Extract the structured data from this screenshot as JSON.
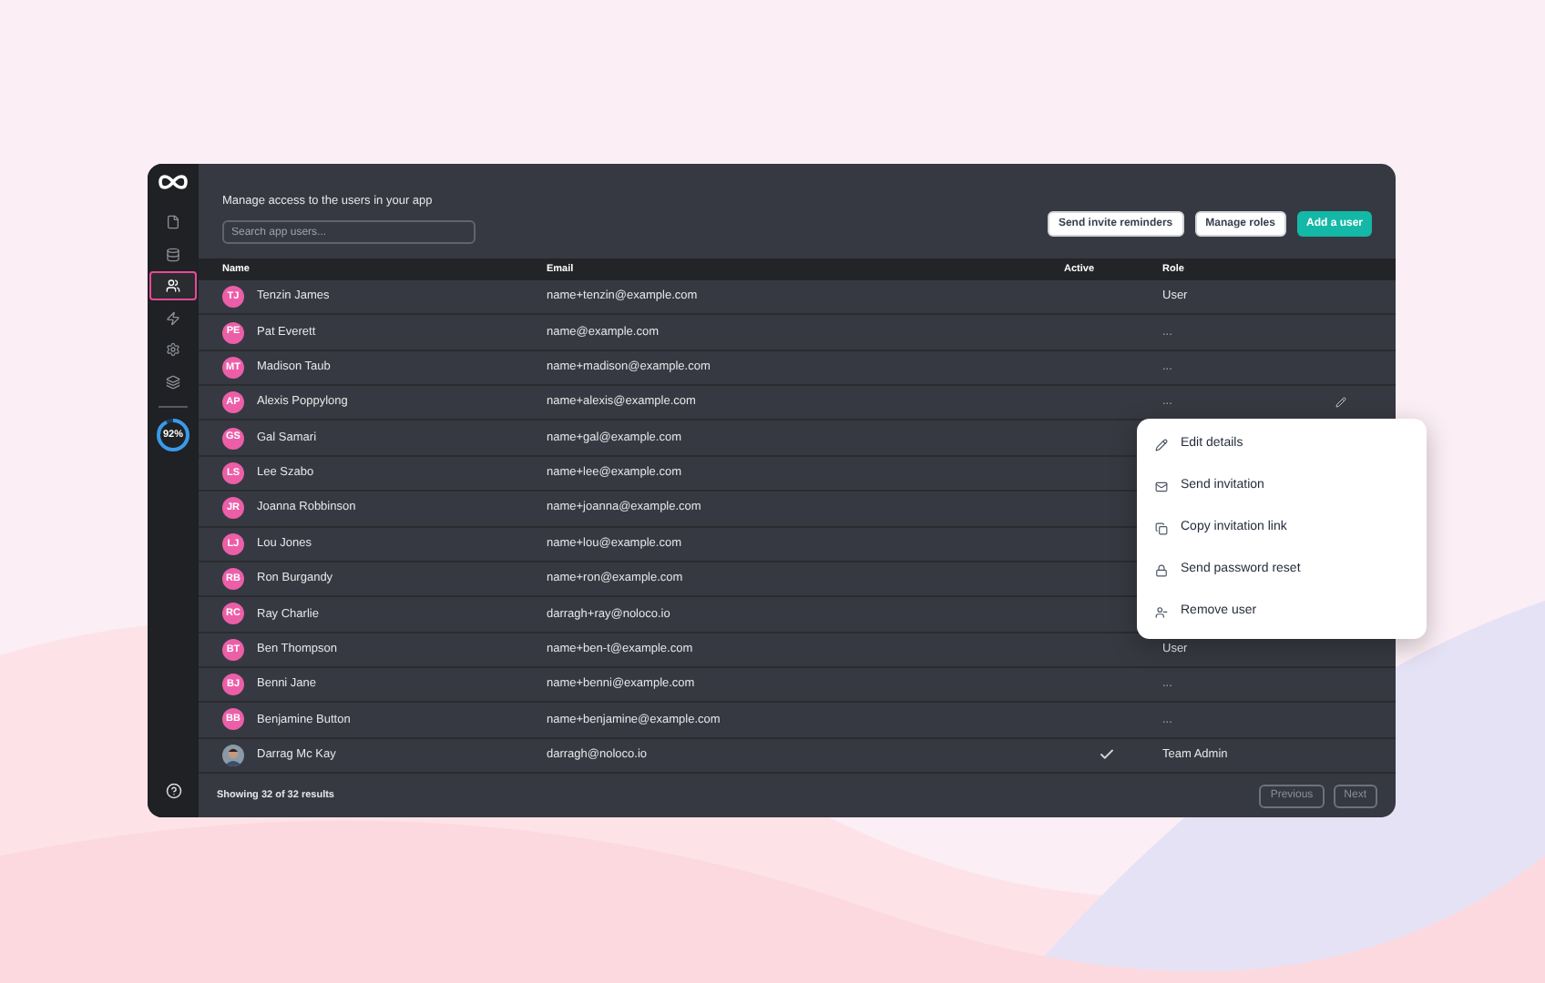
{
  "sidebar": {
    "items": [
      {
        "selected": false
      },
      {
        "selected": false
      },
      {
        "selected": true
      },
      {
        "selected": false
      },
      {
        "selected": false
      },
      {
        "selected": false
      }
    ],
    "usage": {
      "label": "92%"
    }
  },
  "header": {
    "subtitle": "Manage access to the users in your app",
    "search": {
      "placeholder": "Search app users..."
    },
    "buttons": [
      {
        "label": "Send invite reminders",
        "kind": "secondary"
      },
      {
        "label": "Manage roles",
        "kind": "secondary"
      },
      {
        "label": "Add a user",
        "kind": "primary"
      }
    ]
  },
  "table": {
    "columns": [
      "Name",
      "Email",
      "Active",
      "Role"
    ],
    "rows": [
      {
        "kind": "initials",
        "initials": "TJ",
        "name": "Tenzin James",
        "email": "name+tenzin@example.com",
        "active": false,
        "role": "User",
        "edit": false
      },
      {
        "kind": "initials",
        "initials": "PE",
        "name": "Pat Everett",
        "email": "name@example.com",
        "active": false,
        "role": "...",
        "edit": false
      },
      {
        "kind": "initials",
        "initials": "MT",
        "name": "Madison Taub",
        "email": "name+madison@example.com",
        "active": false,
        "role": "...",
        "edit": false
      },
      {
        "kind": "initials",
        "initials": "AP",
        "name": "Alexis Poppylong",
        "email": "name+alexis@example.com",
        "active": false,
        "role": "...",
        "edit": true
      },
      {
        "kind": "initials",
        "initials": "GS",
        "name": "Gal Samari",
        "email": "name+gal@example.com",
        "active": false
      },
      {
        "kind": "initials",
        "initials": "LS",
        "name": "Lee Szabo",
        "email": "name+lee@example.com",
        "active": false
      },
      {
        "kind": "initials",
        "initials": "JR",
        "name": "Joanna Robbinson",
        "email": "name+joanna@example.com",
        "active": false
      },
      {
        "kind": "initials",
        "initials": "LJ",
        "name": "Lou Jones",
        "email": "name+lou@example.com",
        "active": false
      },
      {
        "kind": "initials",
        "initials": "RB",
        "name": "Ron Burgandy",
        "email": "name+ron@example.com",
        "active": false
      },
      {
        "kind": "initials",
        "initials": "RC",
        "name": "Ray Charlie",
        "email": "darragh+ray@noloco.io",
        "active": false
      },
      {
        "kind": "initials",
        "initials": "BT",
        "name": "Ben Thompson",
        "email": "name+ben-t@example.com",
        "active": false,
        "role": "User",
        "edit": false
      },
      {
        "kind": "initials",
        "initials": "BJ",
        "name": "Benni Jane",
        "email": "name+benni@example.com",
        "active": false,
        "role": "...",
        "edit": false
      },
      {
        "kind": "initials",
        "initials": "BB",
        "name": "Benjamine Button",
        "email": "name+benjamine@example.com",
        "active": false,
        "role": "...",
        "edit": false
      },
      {
        "kind": "picture",
        "name": "Darrag Mc Kay",
        "email": "darragh@noloco.io",
        "active": true,
        "role": "Team Admin",
        "edit": false
      }
    ]
  },
  "footer": {
    "summary": "Showing 32 of 32 results",
    "buttons": [
      "Previous",
      "Next"
    ]
  },
  "context_menu": {
    "items": [
      {
        "label": "Edit details"
      },
      {
        "label": "Send invitation"
      },
      {
        "label": "Copy invitation link"
      },
      {
        "label": "Send password reset"
      },
      {
        "label": "Remove user"
      }
    ]
  }
}
